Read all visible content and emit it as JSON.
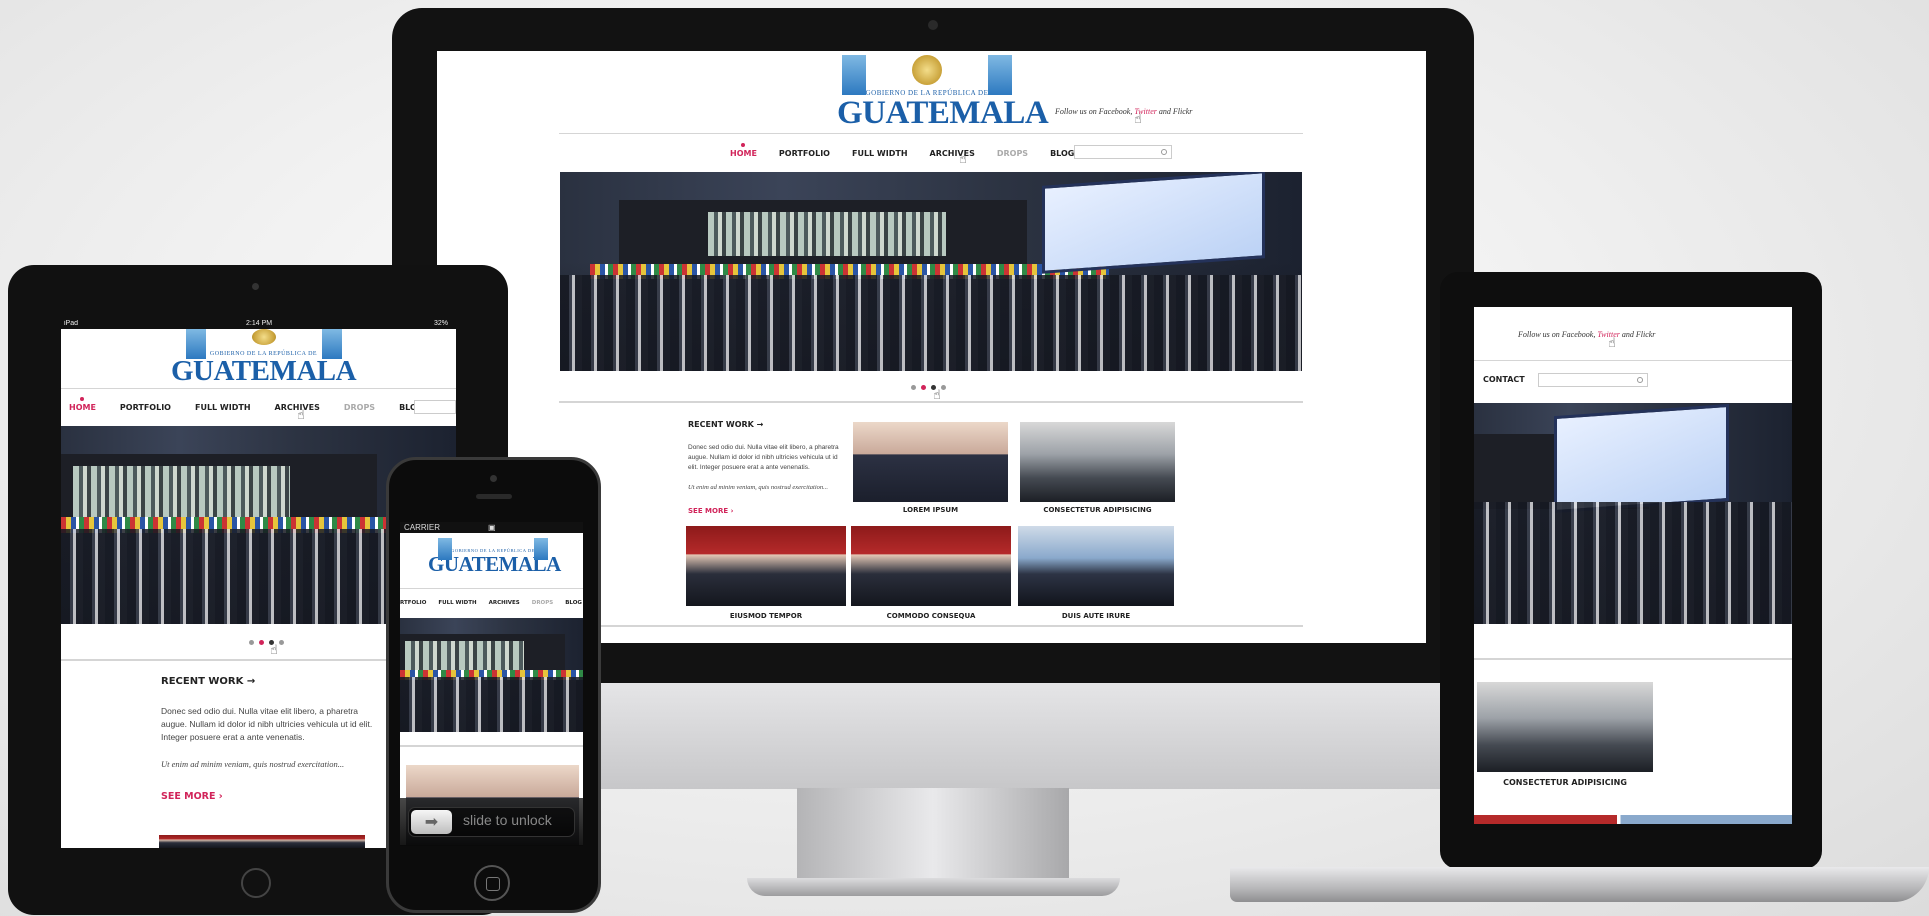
{
  "site": {
    "logo_top": "GOBIERNO DE LA REPÚBLICA DE",
    "logo_name": "GUATEMALA",
    "follow_prefix": "Follow us on Facebook, ",
    "follow_twitter": "Twitter",
    "follow_suffix": " and Flickr",
    "nav": [
      "HOME",
      "PORTFOLIO",
      "FULL WIDTH",
      "ARCHIVES",
      "DROPS",
      "BLOG",
      "CONTACT"
    ],
    "nav_iphone": [
      "RTFOLIO",
      "FULL WIDTH",
      "ARCHIVES",
      "DROPS",
      "BLOG"
    ],
    "recent_work": "RECENT WORK →",
    "body_text": "Donec sed odio dui. Nulla vitae elit libero, a pharetra augue. Nullam id dolor id nibh ultricies vehicula ut id elit. Integer posuere erat a ante venenatis.",
    "body_text_ipad_1": "Donec sed odio dui. Nulla vitae elit libero, a pharetra",
    "body_text_ipad_2": "augue. Nullam id dolor id nibh ultricies vehicula ut id elit.",
    "body_text_ipad_3": "Integer posuere erat a ante venenatis.",
    "quote": "Ut enim ad minim veniam, quis nostrud exercitation...",
    "see_more": "SEE MORE ›",
    "thumbs": [
      {
        "caption": "LOREM IPSUM"
      },
      {
        "caption": "CONSECTETUR ADIPISICING"
      },
      {
        "caption": "EIUSMOD TEMPOR"
      },
      {
        "caption": "COMMODO CONSEQUA"
      },
      {
        "caption": "DUIS AUTE IRURE"
      }
    ]
  },
  "slider": {
    "total_dots": 4,
    "active_dot": 3
  },
  "ipad": {
    "status_left": "iPad",
    "status_time": "2:14 PM",
    "status_right": "32%"
  },
  "iphone": {
    "carrier": "CARRIER",
    "slide_to_unlock": "slide to unlock",
    "arrow": "➡"
  },
  "colors": {
    "accent": "#d1245a",
    "logo_blue": "#1b5fa8"
  },
  "icons": [
    "search-icon",
    "hand-cursor-icon",
    "lock-icon",
    "arrow-right-icon"
  ]
}
